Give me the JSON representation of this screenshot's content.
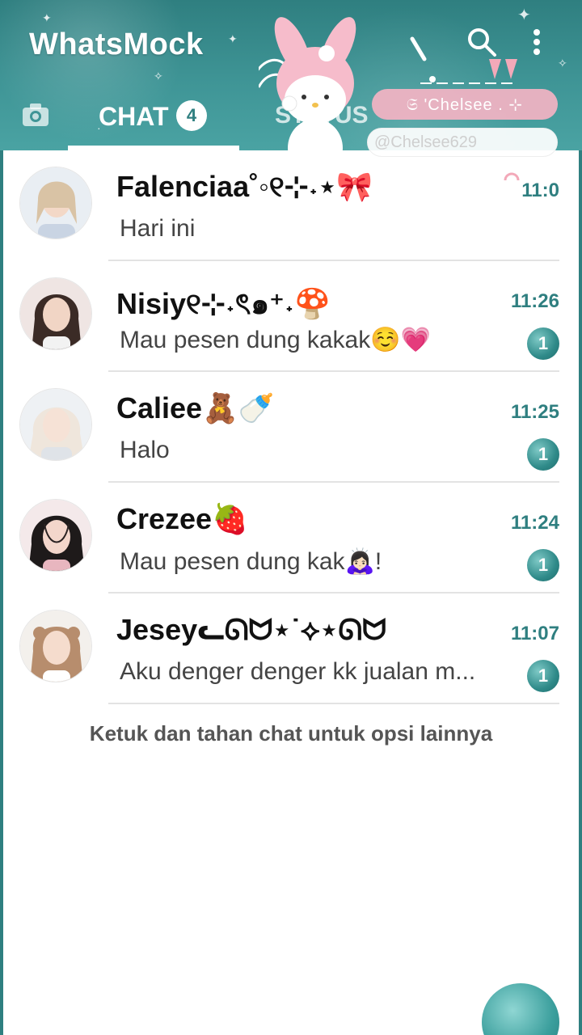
{
  "app": {
    "title": "WhatsMock",
    "accent_color": "#2f7f80"
  },
  "header": {
    "icons": [
      "search-icon",
      "more-vertical-icon",
      "camera-icon"
    ],
    "tabs": [
      {
        "label": "CHAT",
        "badge": "4",
        "active": true
      },
      {
        "label": "STATUS",
        "active": false
      }
    ],
    "sticker_name": "𝔖 'Chelsee . ⊹",
    "sticker_handle": "@Chelsee629"
  },
  "chats": [
    {
      "name": "Falenciaa˚◦୧⊹˖⋆🎀",
      "time": "11:0",
      "preview": "Hari ini",
      "unread": null
    },
    {
      "name": "Nisiy୧⊹˖ৎ๑⁺˖🍄",
      "time": "11:26",
      "preview": "Mau pesen dung kakak☺️💗",
      "unread": "1"
    },
    {
      "name": "Caliee🧸🍼",
      "time": "11:25",
      "preview": "Halo",
      "unread": "1"
    },
    {
      "name": "Crezee🍓",
      "time": "11:24",
      "preview": "Mau pesen dung kak🙇🏻‍♀️!",
      "unread": "1"
    },
    {
      "name": "Jeseyᓚᘏᗢ⋆˙⟡⋆ᘏᗢ",
      "time": "11:07",
      "preview": "Aku denger denger kk jualan m...",
      "unread": "1"
    }
  ],
  "hint": "Ketuk dan tahan chat untuk opsi lainnya"
}
